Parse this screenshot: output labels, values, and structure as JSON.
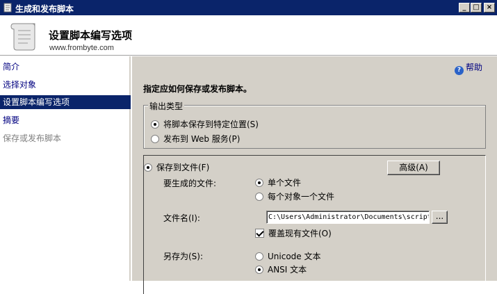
{
  "window": {
    "title": "生成和发布脚本",
    "minimize_glyph": "_",
    "maximize_glyph": "□",
    "close_glyph": "×"
  },
  "header": {
    "heading": "设置脚本编写选项",
    "site": "www.frombyte.com"
  },
  "sidebar": {
    "items": [
      {
        "label": "简介"
      },
      {
        "label": "选择对象"
      },
      {
        "label": "设置脚本编写选项"
      },
      {
        "label": "摘要"
      },
      {
        "label": "保存或发布脚本"
      }
    ]
  },
  "main": {
    "help_label": "帮助",
    "help_glyph": "?",
    "instruction": "指定应如何保存或发布脚本。",
    "output_type": {
      "legend": "输出类型",
      "options": [
        {
          "label": "将脚本保存到特定位置(S)",
          "selected": true
        },
        {
          "label": "发布到 Web 服务(P)",
          "selected": false
        }
      ]
    },
    "save_to_file": {
      "label": "保存到文件(F)",
      "advanced_button": "高级(A)",
      "files_to_generate_label": "要生成的文件:",
      "file_options": [
        {
          "label": "单个文件",
          "selected": true
        },
        {
          "label": "每个对象一个文件",
          "selected": false
        }
      ],
      "filename_label": "文件名(I):",
      "filename_value": "C:\\Users\\Administrator\\Documents\\script",
      "browse_button": "...",
      "overwrite_label": "覆盖现有文件(O)",
      "overwrite_checked": true,
      "save_as_label": "另存为(S):",
      "encoding_options": [
        {
          "label": "Unicode 文本",
          "selected": false
        },
        {
          "label": "ANSI 文本",
          "selected": true
        }
      ]
    }
  },
  "colors": {
    "title_bar": "#0a246a",
    "dialog_face": "#d4d0c8",
    "nav_link": "#000080",
    "nav_active_bg": "#0a246a"
  }
}
